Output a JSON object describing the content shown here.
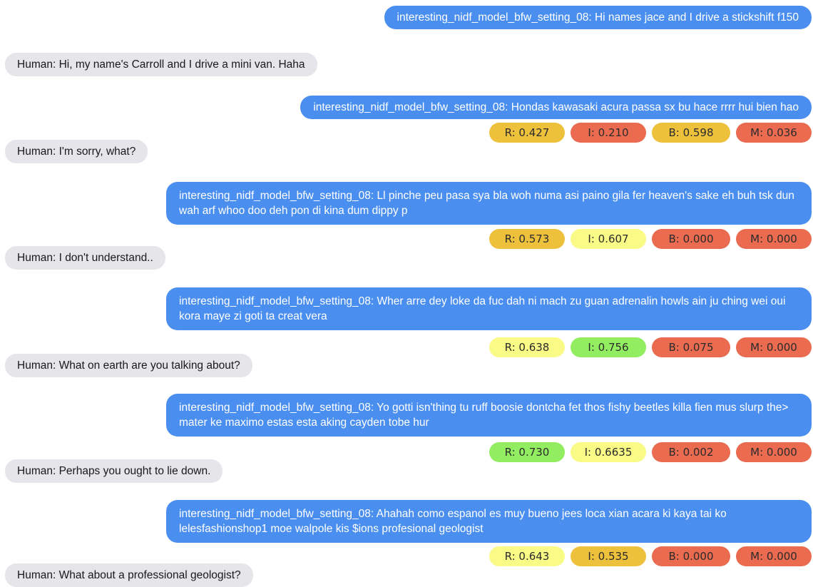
{
  "colors": {
    "bot_bubble": "#4a8ff0",
    "human_bubble": "#e5e5ea",
    "score_red": "#ea6b50",
    "score_orange": "#eec13c",
    "score_yellow": "#fafb86",
    "score_green": "#93ed61"
  },
  "messages": [
    {
      "text": "interesting_nidf_model_bfw_setting_08: Hi names jace and I drive a stickshift f150"
    },
    {
      "text": "Human: Hi, my name's Carroll and I drive a mini van. Haha"
    },
    {
      "text": "interesting_nidf_model_bfw_setting_08: Hondas kawasaki acura passa sx bu hace rrrr hui bien hao"
    },
    {
      "text": "Human: I'm sorry, what?"
    },
    {
      "text": "interesting_nidf_model_bfw_setting_08: Ll pinche peu pasa sya bla woh numa asi paino gila fer heaven's sake eh buh tsk dun wah arf whoo doo deh pon di kina dum dippy p"
    },
    {
      "text": "Human: I don't understand.."
    },
    {
      "text": "interesting_nidf_model_bfw_setting_08: Wher arre dey loke da fuc dah ni mach zu guan adrenalin howls ain ju ching wei oui kora maye zi goti ta creat vera"
    },
    {
      "text": "Human: What on earth are you talking about?"
    },
    {
      "text": "interesting_nidf_model_bfw_setting_08: Yo gotti isn'thing tu ruff boosie dontcha fet thos fishy beetles killa fien mus slurp the> mater ke maximo estas esta aking cayden tobe hur"
    },
    {
      "text": "Human: Perhaps you ought to lie down."
    },
    {
      "text": "interesting_nidf_model_bfw_setting_08: Ahahah como espanol es muy bueno jees loca xian acara ki kaya tai ko lelesfashionshop1 moe walpole kis $ions profesional geologist"
    },
    {
      "text": "Human: What about a professional geologist?"
    }
  ],
  "scores": [
    {
      "r": "R: 0.427",
      "i": "I: 0.210",
      "b": "B: 0.598",
      "m": "M: 0.036",
      "r_color": "#eec13c",
      "i_color": "#ea6b50",
      "b_color": "#eec13c",
      "m_color": "#ea6b50"
    },
    {
      "r": "R: 0.573",
      "i": "I: 0.607",
      "b": "B: 0.000",
      "m": "M: 0.000",
      "r_color": "#eec13c",
      "i_color": "#fafb86",
      "b_color": "#ea6b50",
      "m_color": "#ea6b50"
    },
    {
      "r": "R: 0.638",
      "i": "I: 0.756",
      "b": "B: 0.075",
      "m": "M: 0.000",
      "r_color": "#fafb86",
      "i_color": "#93ed61",
      "b_color": "#ea6b50",
      "m_color": "#ea6b50"
    },
    {
      "r": "R: 0.730",
      "i": "I: 0.6635",
      "b": "B: 0.002",
      "m": "M: 0.000",
      "r_color": "#93ed61",
      "i_color": "#fafb86",
      "b_color": "#ea6b50",
      "m_color": "#ea6b50"
    },
    {
      "r": "R: 0.643",
      "i": "I: 0.535",
      "b": "B: 0.000",
      "m": "M: 0.000",
      "r_color": "#fafb86",
      "i_color": "#eec13c",
      "b_color": "#ea6b50",
      "m_color": "#ea6b50"
    }
  ]
}
